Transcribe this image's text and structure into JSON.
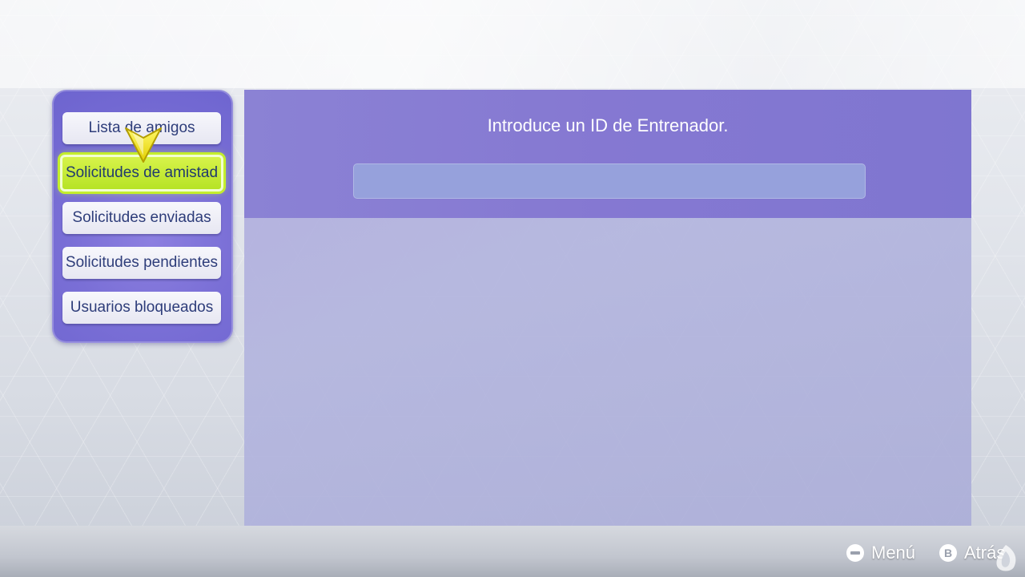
{
  "sidebar": {
    "items": [
      {
        "label": "Lista de amigos"
      },
      {
        "label": "Solicitudes de amistad"
      },
      {
        "label": "Solicitudes enviadas"
      },
      {
        "label": "Solicitudes pendientes"
      },
      {
        "label": "Usuarios bloqueados"
      }
    ],
    "selected_index": 1
  },
  "main": {
    "prompt": "Introduce un ID de Entrenador.",
    "trainer_id_input": {
      "value": "",
      "placeholder": ""
    }
  },
  "footer": {
    "menu": {
      "button": "minus-button-icon",
      "label": "Menú"
    },
    "back": {
      "button": "B",
      "label": "Atrás"
    }
  },
  "colors": {
    "panel_purple": "#7a6fd6",
    "selected_green": "#c4ee2c",
    "header_purple": "#8578d2",
    "input_fill": "#96a1dc",
    "cursor_yellow": "#f2e51a"
  },
  "icons": {
    "cursor": "arrow-cursor-icon",
    "logo": "site-watermark-logo"
  }
}
